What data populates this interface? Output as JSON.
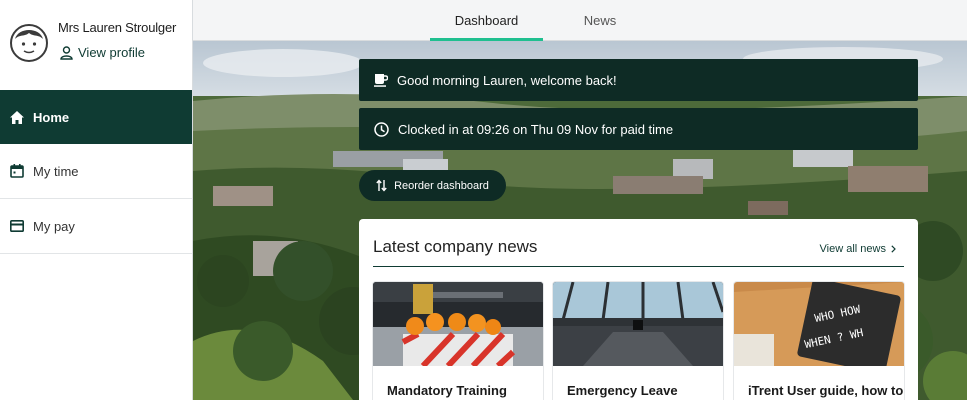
{
  "profile": {
    "name": "Mrs Lauren Stroulger",
    "view_profile": "View profile"
  },
  "nav": {
    "home": "Home",
    "my_time": "My time",
    "my_pay": "My pay"
  },
  "tabs": {
    "dashboard": "Dashboard",
    "news": "News"
  },
  "banners": {
    "greeting": "Good morning Lauren, welcome back!",
    "clock": "Clocked in at 09:26 on Thu 09 Nov for paid time"
  },
  "reorder_label": "Reorder dashboard",
  "news": {
    "title": "Latest company news",
    "view_all": "View all news",
    "articles": [
      {
        "title": "Mandatory Training"
      },
      {
        "title": "Emergency Leave"
      },
      {
        "title": "iTrent User guide, how to"
      }
    ]
  },
  "colors": {
    "brand_dark": "#0f3b33",
    "banner_bg": "#0e2b25",
    "tab_accent": "#1fbf8f"
  },
  "icons": [
    "avatar-icon",
    "person-icon",
    "home-icon",
    "calendar-icon",
    "card-icon",
    "coffee-icon",
    "clock-icon",
    "reorder-icon",
    "chevron-right-icon"
  ]
}
